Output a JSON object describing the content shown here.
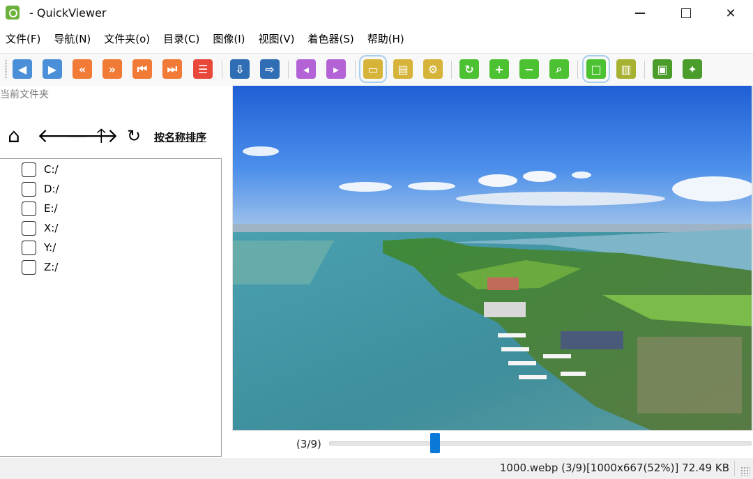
{
  "window": {
    "title": " - QuickViewer"
  },
  "menu": [
    "文件(F)",
    "导航(N)",
    "文件夹(o)",
    "目录(C)",
    "图像(I)",
    "视图(V)",
    "着色器(S)",
    "帮助(H)"
  ],
  "left_panel": {
    "label": "当前文件夹",
    "sort_label": "按名称排序",
    "drives": [
      "C:/",
      "D:/",
      "E:/",
      "X:/",
      "Y:/",
      "Z:/"
    ]
  },
  "viewer": {
    "page_indicator": "(3/9)",
    "slider_position": 0.25
  },
  "status": {
    "text": "1000.webp (3/9)[1000x667(52%)] 72.49 KB"
  },
  "colors": {
    "accent": "#0a78d7",
    "tool_blue": "#4b8fd8",
    "tool_orange": "#f07a36",
    "tool_green": "#4cc233"
  }
}
